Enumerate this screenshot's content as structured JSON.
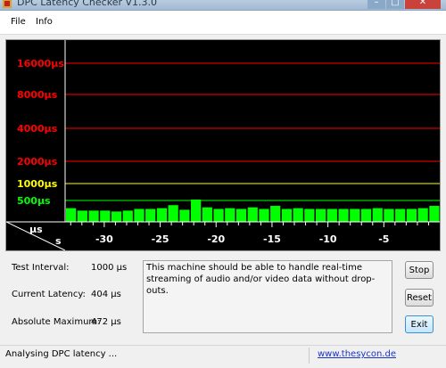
{
  "window": {
    "title": "DPC Latency Checker V1.3.0",
    "controls": {
      "minimize": "–",
      "maximize": "□",
      "close": "✕"
    }
  },
  "menu": [
    "File",
    "Info"
  ],
  "chart_data": {
    "type": "bar",
    "y_scale": "log2",
    "y_labels": [
      "16000µs",
      "8000µs",
      "4000µs",
      "2000µs",
      "1000µs",
      "500µs"
    ],
    "y_ticks": [
      16000,
      8000,
      4000,
      2000,
      1000,
      500
    ],
    "y_label_colors": [
      "#ff0000",
      "#ff0000",
      "#ff0000",
      "#ff0000",
      "#ffff00",
      "#00ff00"
    ],
    "x_ticks": [
      "-30",
      "-25",
      "-20",
      "-15",
      "-10",
      "-5"
    ],
    "x_tick_values": [
      -30,
      -25,
      -20,
      -15,
      -10,
      -5
    ],
    "corner_top": "µs",
    "corner_bottom": "s",
    "bar_color": "#00ff00",
    "x": [
      -33,
      -32,
      -31,
      -30,
      -29,
      -28,
      -27,
      -26,
      -25,
      -24,
      -23,
      -22,
      -21,
      -20,
      -19,
      -18,
      -17,
      -16,
      -15,
      -14,
      -13,
      -12,
      -11,
      -10,
      -9,
      -8,
      -7,
      -6,
      -5,
      -4,
      -3,
      -2,
      -1
    ],
    "values": [
      390,
      360,
      360,
      360,
      350,
      360,
      380,
      380,
      390,
      430,
      370,
      520,
      400,
      380,
      390,
      380,
      400,
      380,
      420,
      380,
      390,
      380,
      380,
      380,
      380,
      380,
      380,
      390,
      380,
      380,
      380,
      390,
      420
    ]
  },
  "info": {
    "test_interval_label": "Test Interval:",
    "test_interval_value": "1000 µs",
    "current_latency_label": "Current Latency:",
    "current_latency_value": "404 µs",
    "absolute_max_label": "Absolute Maximum:",
    "absolute_max_value": "472 µs"
  },
  "message": "This machine should be able to handle real-time streaming of audio and/or video data without drop-outs.",
  "buttons": {
    "stop": "Stop",
    "reset": "Reset",
    "exit": "Exit"
  },
  "status": {
    "text": "Analysing DPC latency ...",
    "link": "www.thesycon.de"
  }
}
